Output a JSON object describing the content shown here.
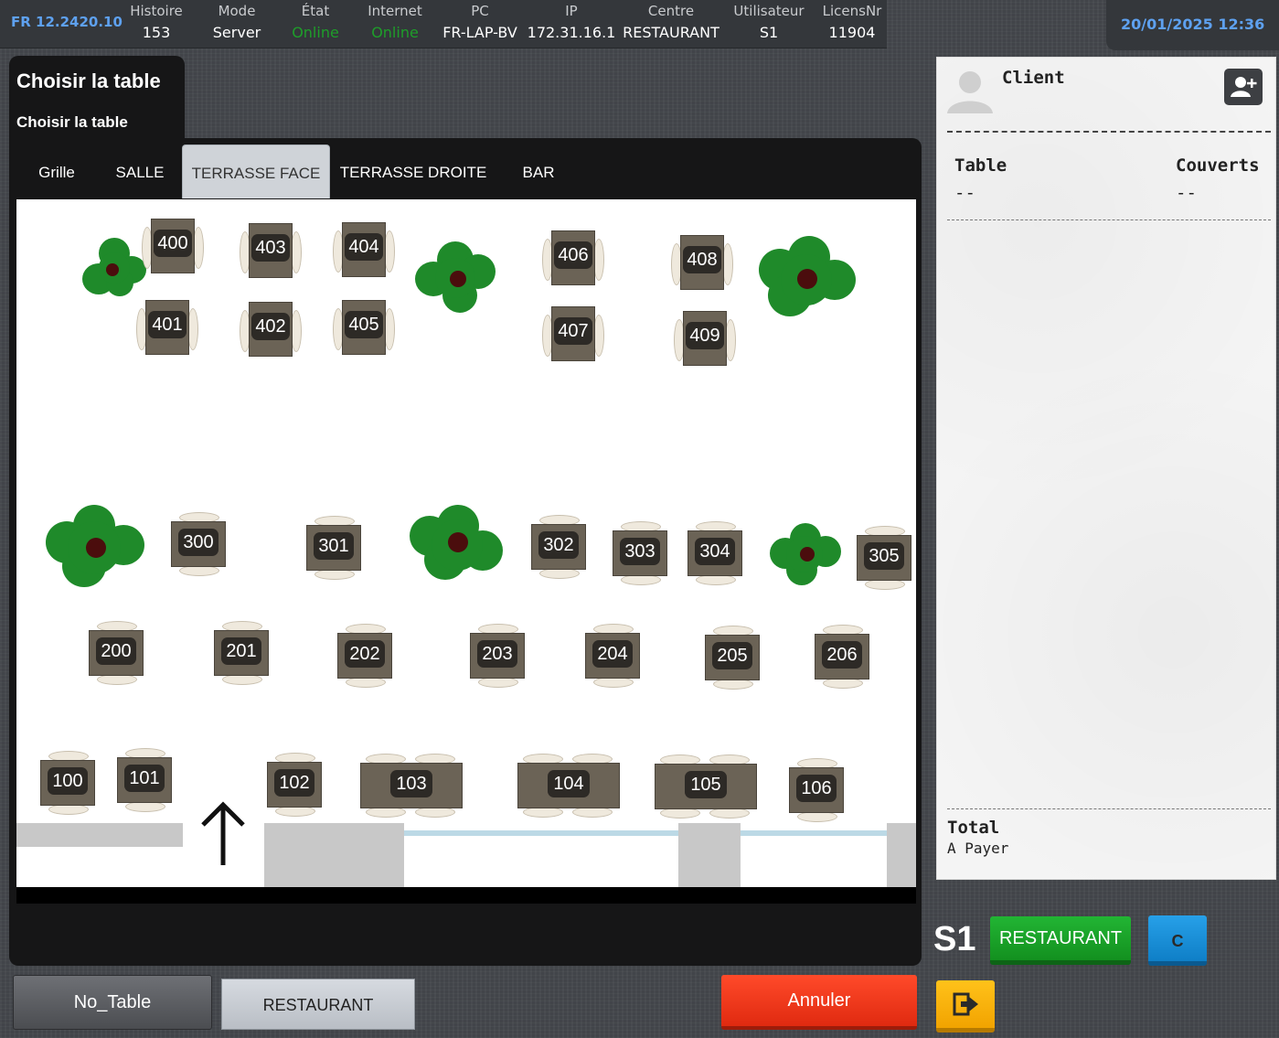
{
  "header": {
    "version": "FR 12.2420.10",
    "fields": [
      {
        "key": "Histoire",
        "value": "153"
      },
      {
        "key": "Mode",
        "value": "Server"
      },
      {
        "key": "État",
        "value": "Online"
      },
      {
        "key": "Internet",
        "value": "Online"
      },
      {
        "key": "PC",
        "value": "FR-LAP-BV"
      },
      {
        "key": "IP",
        "value": "172.31.16.1"
      },
      {
        "key": "Centre",
        "value": "RESTAURANT"
      },
      {
        "key": "Utilisateur",
        "value": "S1"
      },
      {
        "key": "LicensNr",
        "value": "11904"
      }
    ],
    "datetime": "20/01/2025 12:36",
    "status_color": "#1e9e2a"
  },
  "panel": {
    "title": "Choisir la table",
    "subtitle": "Choisir la table"
  },
  "tabs": [
    {
      "label": "Grille",
      "active": false
    },
    {
      "label": "SALLE",
      "active": false
    },
    {
      "label": "TERRASSE FACE",
      "active": true
    },
    {
      "label": "TERRASSE DROITE",
      "active": false
    },
    {
      "label": "BAR",
      "active": false
    }
  ],
  "tables": {
    "t400": "400",
    "t401": "401",
    "t402": "402",
    "t403": "403",
    "t404": "404",
    "t405": "405",
    "t406": "406",
    "t407": "407",
    "t408": "408",
    "t409": "409",
    "t300": "300",
    "t301": "301",
    "t302": "302",
    "t303": "303",
    "t304": "304",
    "t305": "305",
    "t200": "200",
    "t201": "201",
    "t202": "202",
    "t203": "203",
    "t204": "204",
    "t205": "205",
    "t206": "206",
    "t100": "100",
    "t101": "101",
    "t102": "102",
    "t103": "103",
    "t104": "104",
    "t105": "105",
    "t106": "106"
  },
  "receipt": {
    "client_label": "Client",
    "table_label": "Table",
    "table_value": "--",
    "covers_label": "Couverts",
    "covers_value": "--",
    "total_label": "Total",
    "to_pay_label": "A Payer"
  },
  "footer": {
    "no_table": "No_Table",
    "restaurant_center": "RESTAURANT",
    "cancel": "Annuler",
    "user": "S1",
    "restaurant": "RESTAURANT",
    "c_button": "C"
  },
  "icons": {
    "avatar": "user-silhouette-icon",
    "add_client": "add-user-icon",
    "exit": "exit-icon",
    "direction": "arrow-up-icon",
    "plant": "plant-icon"
  },
  "colors": {
    "accent_blue": "#5ea1f0",
    "online_green": "#1e9e2a",
    "cancel_red": "#e02a10",
    "restaurant_green": "#13901f",
    "c_blue": "#0f7fc7",
    "exit_yellow": "#f2a300"
  }
}
